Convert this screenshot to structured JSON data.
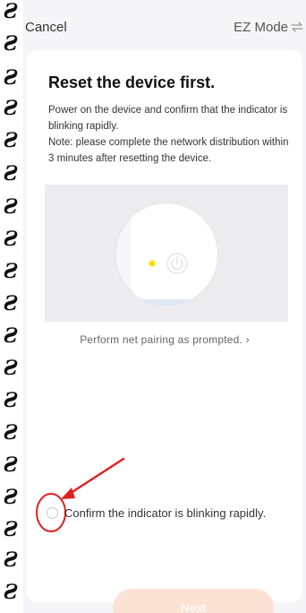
{
  "header": {
    "cancel_label": "Cancel",
    "mode_label": "EZ Mode",
    "mode_icon": "swap-arrows-icon"
  },
  "card": {
    "title": "Reset the device first.",
    "description_line1": "Power on the device and confirm that the indicator is blinking rapidly.",
    "description_line2": "Note: please complete the network distribution within 3 minutes after resetting the device.",
    "pairing_link": "Perform net pairing as prompted. ›",
    "confirm_label": "Confirm the indicator is blinking rapidly.",
    "confirm_checked": false,
    "next_label": "Next",
    "next_enabled": false
  },
  "illustration": {
    "indicator_color": "#f5e000",
    "power_icon": "power-icon"
  },
  "annotation": {
    "color": "#e02020"
  },
  "decor": {
    "glyph": "Ƨ"
  },
  "colors": {
    "accent": "#ff5a00",
    "button_disabled_bg": "#fbe2d5",
    "background": "#f5f5f7"
  }
}
